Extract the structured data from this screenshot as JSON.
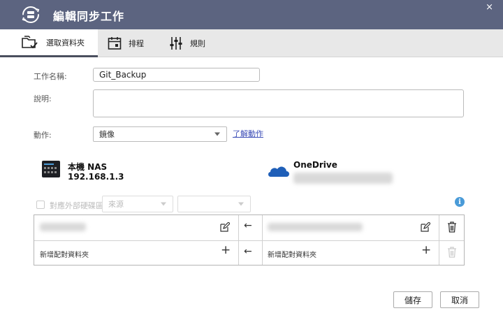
{
  "window": {
    "title": "編輯同步工作",
    "close_glyph": "×"
  },
  "tabs": [
    {
      "label": "選取資料夾",
      "icon": "folder-select-icon",
      "active": true
    },
    {
      "label": "排程",
      "icon": "calendar-icon",
      "active": false
    },
    {
      "label": "規則",
      "icon": "sliders-icon",
      "active": false
    }
  ],
  "form": {
    "job_name_label": "工作名稱:",
    "job_name_value": "Git_Backup",
    "description_label": "說明:",
    "description_value": "",
    "action_label": "動作:",
    "action_value": "鏡像",
    "action_link": "了解動作"
  },
  "source": {
    "name": "本機 NAS",
    "address": "192.168.1.3"
  },
  "destination": {
    "name": "OneDrive"
  },
  "external_drive": {
    "checkbox_label": "對應外部硬碟區",
    "source_select": "來源",
    "second_select": ""
  },
  "pairs": {
    "add_local_label": "新增配對資料夾",
    "add_remote_label": "新增配對資料夾",
    "arrow": "←",
    "plus": "+"
  },
  "footer": {
    "save_label": "儲存",
    "cancel_label": "取消"
  },
  "colors": {
    "titlebar": "#5c6480",
    "link": "#3a4bb6",
    "onedrive": "#1f5fb8",
    "info": "#4a9bd8"
  }
}
